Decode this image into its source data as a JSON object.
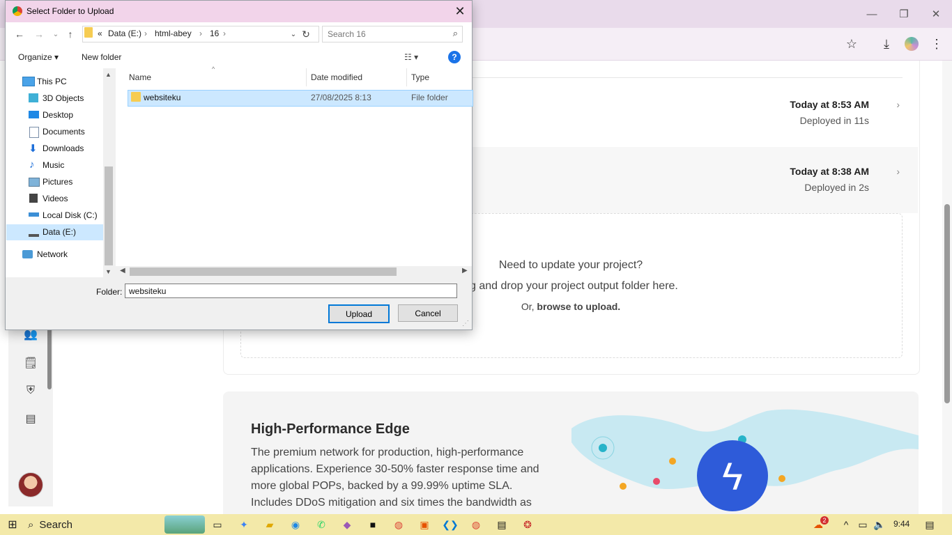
{
  "browser": {
    "minimize": "—",
    "restore": "❐",
    "close": "✕",
    "toolbar_icons": [
      "star-icon",
      "download-icon",
      "profile-icon",
      "menu-icon"
    ]
  },
  "deployments": [
    {
      "time": "Today at 8:53 AM",
      "status": "Deployed in 11s"
    },
    {
      "time": "Today at 8:38 AM",
      "status": "Deployed in 2s"
    }
  ],
  "dropzone": {
    "heading": "Need to update your project?",
    "instruction": "ag and drop your project output folder here.",
    "alt_prefix": "Or,",
    "alt_link": "browse to upload."
  },
  "edge": {
    "title": "High-Performance Edge",
    "description": "The premium network for production, high-performance applications. Experience 30-50% faster response time and more global POPs, backed by a 99.99% uptime SLA. Includes DDoS mitigation and six times the bandwidth as"
  },
  "dialog": {
    "title": "Select Folder to Upload",
    "path": [
      "«",
      "Data (E:)",
      "›",
      "html-abey",
      "›",
      "16",
      "›"
    ],
    "search_placeholder": "Search 16",
    "organize": "Organize ▾",
    "new_folder": "New folder",
    "tree": [
      {
        "label": "This PC",
        "icon": "pc-icon"
      },
      {
        "label": "3D Objects",
        "icon": "cube-icon"
      },
      {
        "label": "Desktop",
        "icon": "desktop-icon"
      },
      {
        "label": "Documents",
        "icon": "documents-icon"
      },
      {
        "label": "Downloads",
        "icon": "downloads-icon"
      },
      {
        "label": "Music",
        "icon": "music-icon"
      },
      {
        "label": "Pictures",
        "icon": "pictures-icon"
      },
      {
        "label": "Videos",
        "icon": "videos-icon"
      },
      {
        "label": "Local Disk (C:)",
        "icon": "disk-icon"
      },
      {
        "label": "Data (E:)",
        "icon": "drive-icon"
      },
      {
        "label": "Network",
        "icon": "network-icon"
      }
    ],
    "columns": [
      "Name",
      "Date modified",
      "Type"
    ],
    "files": [
      {
        "name": "websiteku",
        "date": "27/08/2025 8:13",
        "type": "File folder"
      }
    ],
    "folder_label": "Folder:",
    "folder_value": "websiteku",
    "upload": "Upload",
    "cancel": "Cancel"
  },
  "taskbar": {
    "search": "Search",
    "time": "9:44",
    "notification_count": "2"
  }
}
